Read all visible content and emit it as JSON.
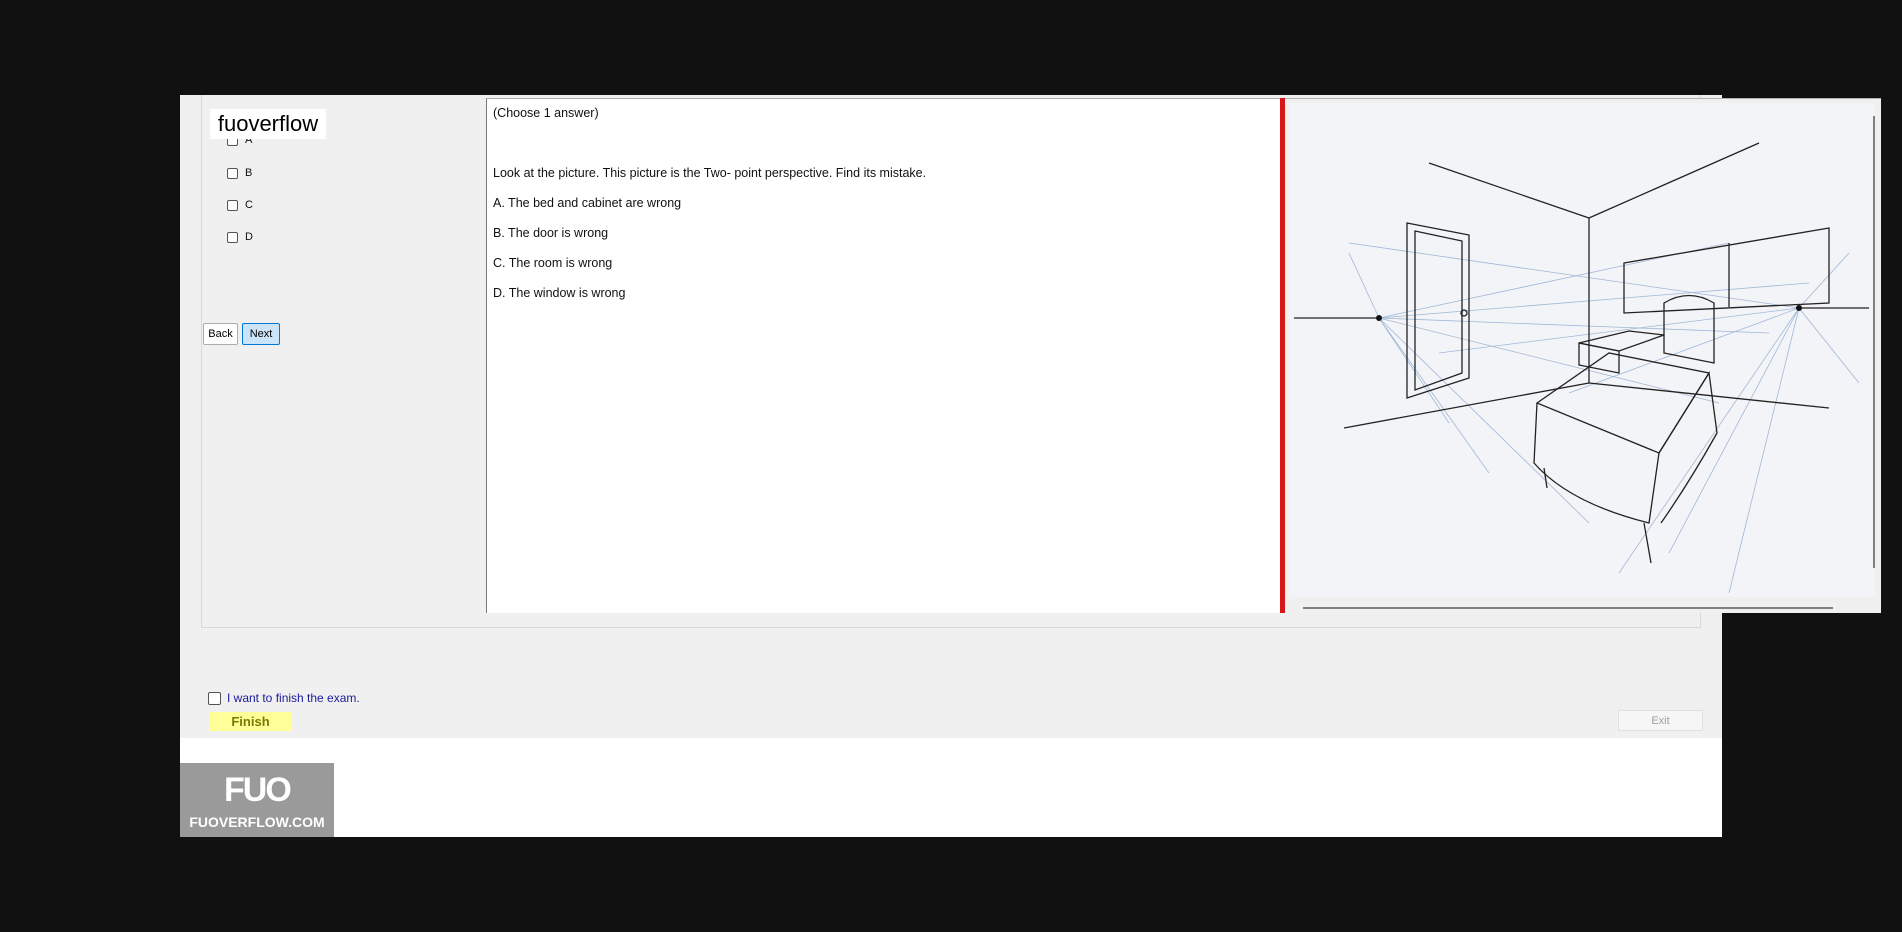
{
  "answers": {
    "options": [
      {
        "letter": "A"
      },
      {
        "letter": "B"
      },
      {
        "letter": "C"
      },
      {
        "letter": "D"
      }
    ]
  },
  "nav": {
    "back_label": "Back",
    "next_label": "Next"
  },
  "question": {
    "instruction": "(Choose 1 answer)",
    "text": "Look at the picture. This picture is the Two- point perspective. Find its mistake.",
    "choices": [
      "A.  The bed and cabinet are wrong",
      "B.  The door is wrong",
      "C.  The room is wrong",
      "D.  The window is wrong"
    ]
  },
  "watermark": {
    "text": "fuoverflow"
  },
  "footer": {
    "finish_checkbox_label": "I want to finish the exam.",
    "finish_label": "Finish",
    "exit_label": "Exit"
  },
  "logo": {
    "mark": "FUO",
    "site": "FUOVERFLOW.COM"
  },
  "colors": {
    "splitter": "#d81818",
    "next_button": "#cce4f7",
    "finish_button": "#ffff99"
  }
}
